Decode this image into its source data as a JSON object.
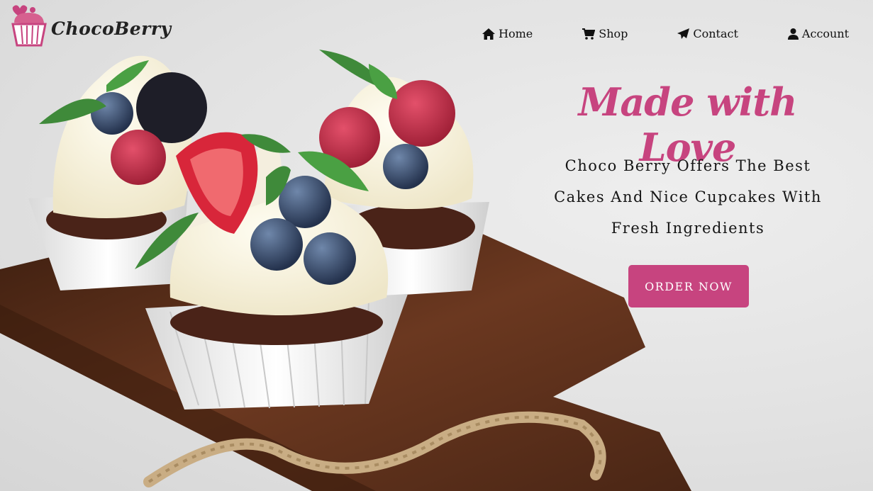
{
  "brand": {
    "name": "ChocoBerry"
  },
  "nav": {
    "items": [
      {
        "label": "Home",
        "icon": "home-icon"
      },
      {
        "label": "Shop",
        "icon": "cart-icon"
      },
      {
        "label": "Contact",
        "icon": "paper-plane-icon"
      },
      {
        "label": "Account",
        "icon": "user-icon"
      }
    ]
  },
  "hero": {
    "headline": "Made with Love",
    "subtext": "Choco Berry Offers The Best Cakes And Nice Cupcakes With Fresh Ingredients",
    "cta_label": "ORDER NOW"
  },
  "colors": {
    "accent": "#c7447f",
    "text": "#151515",
    "background": "#e4e4e4",
    "board": "#5a2d18"
  }
}
